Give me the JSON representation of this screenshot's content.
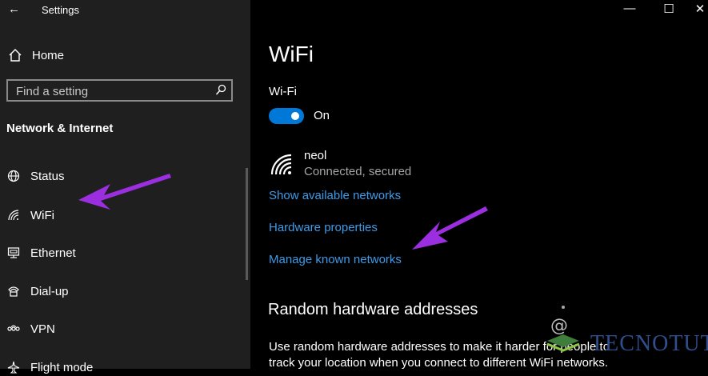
{
  "window": {
    "title": "Settings",
    "back_icon": "back-arrow-icon",
    "controls": [
      "minimize-icon",
      "maximize-icon",
      "close-icon"
    ]
  },
  "sidebar": {
    "home": {
      "label": "Home",
      "icon": "home-icon"
    },
    "search": {
      "placeholder": "Find a setting",
      "icon": "search-icon"
    },
    "section_title": "Network & Internet",
    "items": [
      {
        "label": "Status",
        "icon": "globe-icon"
      },
      {
        "label": "WiFi",
        "icon": "wifi-icon",
        "selected": true
      },
      {
        "label": "Ethernet",
        "icon": "ethernet-icon"
      },
      {
        "label": "Dial-up",
        "icon": "dial-up-icon"
      },
      {
        "label": "VPN",
        "icon": "vpn-icon"
      },
      {
        "label": "Flight mode",
        "icon": "airplane-icon"
      }
    ]
  },
  "main": {
    "title": "WiFi",
    "wifi_label": "Wi-Fi",
    "toggle": {
      "state": "On",
      "on": true
    },
    "network": {
      "name": "neol",
      "status": "Connected, secured",
      "icon": "wifi-signal-icon"
    },
    "links": {
      "show_networks": "Show available networks",
      "hardware_properties": "Hardware properties",
      "manage_networks": "Manage known networks"
    },
    "random_hw": {
      "title": "Random hardware addresses",
      "description": "Use random hardware addresses to make it harder for people to track your location when you connect to different WiFi networks."
    }
  },
  "watermark": {
    "text": "TECNOTUTO"
  },
  "colors": {
    "sidebar_bg": "#1f1f1f",
    "content_bg": "#000000",
    "accent": "#0078d7",
    "link": "#3d9be9",
    "annotation_arrow": "#9b2fe0"
  }
}
